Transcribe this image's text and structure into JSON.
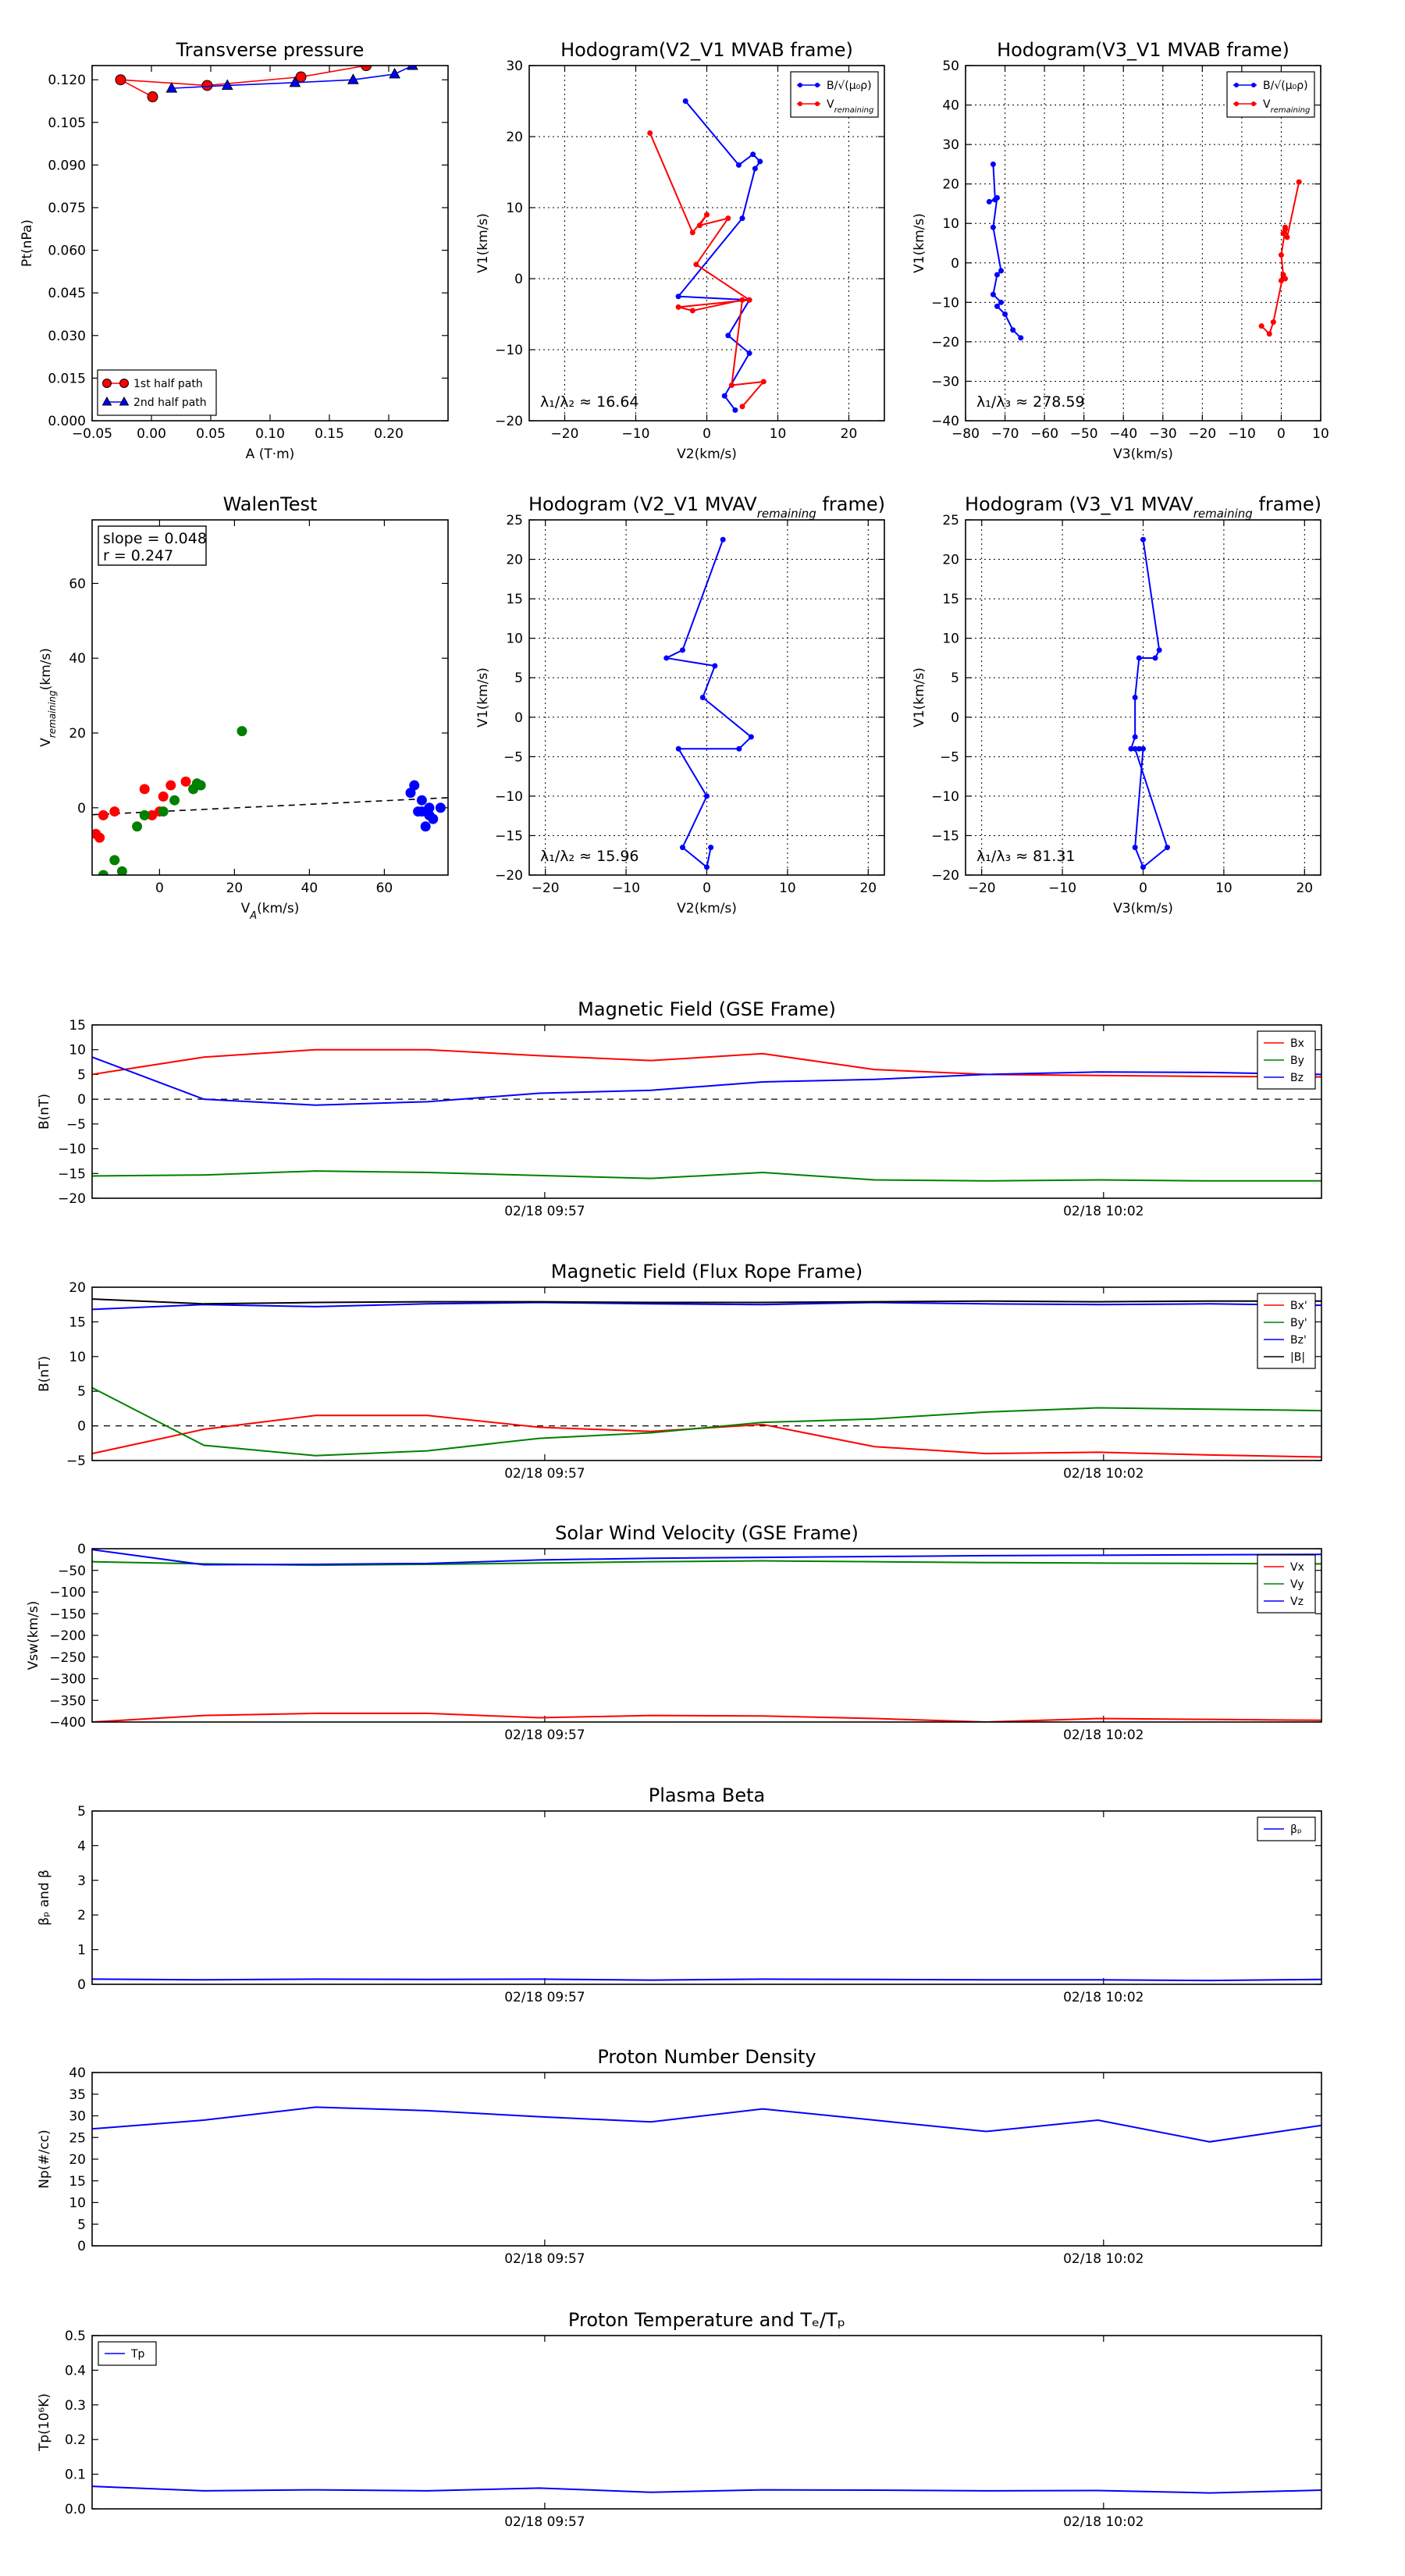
{
  "chart_data": [
    {
      "id": "transverse",
      "type": "line",
      "title": "Transverse pressure",
      "xlabel": "A (T·m)",
      "ylabel": "Pt(nPa)",
      "xlim": [
        -0.05,
        0.25
      ],
      "ylim": [
        0.0,
        0.125
      ],
      "xticks": [
        -0.05,
        0.0,
        0.05,
        0.1,
        0.15,
        0.2
      ],
      "xticklabels": [
        "−0.05",
        "0.00",
        "0.05",
        "0.10",
        "0.15",
        "0.20"
      ],
      "yticks": [
        0,
        0.015,
        0.03,
        0.045,
        0.06,
        0.075,
        0.09,
        0.105,
        0.12
      ],
      "yticklabels": [
        "0.000",
        "0.015",
        "0.030",
        "0.045",
        "0.060",
        "0.075",
        "0.090",
        "0.105",
        "0.120"
      ],
      "legend_position": "lower-left",
      "series": [
        {
          "name": "1st half path",
          "color": "#ff0000",
          "marker": "circle",
          "x": [
            0.001,
            -0.026,
            0.047,
            0.126,
            0.181,
            0.22,
            0.245
          ],
          "y": [
            0.114,
            0.12,
            0.118,
            0.121,
            0.125,
            0.126,
            0.128
          ]
        },
        {
          "name": "2nd half path",
          "color": "#0000ff",
          "marker": "triangle",
          "x": [
            0.017,
            0.064,
            0.121,
            0.17,
            0.205,
            0.22
          ],
          "y": [
            0.117,
            0.118,
            0.119,
            0.12,
            0.122,
            0.125
          ]
        }
      ]
    },
    {
      "id": "hodo_v2_mvab",
      "type": "line",
      "title": "Hodogram(V2_V1 MVAB frame)",
      "xlabel": "V2(km/s)",
      "ylabel": "V1(km/s)",
      "xlim": [
        -25,
        25
      ],
      "ylim": [
        -20,
        30
      ],
      "xticks": [
        -20,
        -10,
        0,
        10,
        20
      ],
      "yticks": [
        -20,
        -10,
        0,
        10,
        20,
        30
      ],
      "grid": true,
      "legend_position": "top-right",
      "annotation": "λ₁/λ₂ ≈ 16.64",
      "series": [
        {
          "name": "B/√(μ₀ρ)",
          "color": "#0000ff",
          "x": [
            -3,
            4.5,
            6.5,
            7.5,
            6.8,
            5,
            -4,
            6,
            3,
            6,
            2.5,
            4
          ],
          "y": [
            25,
            16,
            17.5,
            16.5,
            15.5,
            8.5,
            -2.5,
            -3,
            -8,
            -10.5,
            -16.5,
            -18.5
          ]
        },
        {
          "name": "V_remaining",
          "color": "#ff0000",
          "x": [
            -8,
            -2,
            0,
            -1,
            3,
            -1.5,
            6,
            -4,
            -2,
            5,
            3.5,
            8,
            5
          ],
          "y": [
            20.5,
            6.5,
            9,
            7.5,
            8.5,
            2,
            -3,
            -4,
            -4.5,
            -3,
            -15,
            -14.5,
            -18
          ]
        }
      ]
    },
    {
      "id": "hodo_v3_mvab",
      "type": "line",
      "title": "Hodogram(V3_V1 MVAB frame)",
      "xlabel": "V3(km/s)",
      "ylabel": "V1(km/s)",
      "xlim": [
        -80,
        10
      ],
      "ylim": [
        -40,
        50
      ],
      "xticks": [
        -80,
        -70,
        -60,
        -50,
        -40,
        -30,
        -20,
        -10,
        0,
        10
      ],
      "yticks": [
        -40,
        -30,
        -20,
        -10,
        0,
        10,
        20,
        30,
        40,
        50
      ],
      "grid": true,
      "legend_position": "top-right",
      "annotation": "λ₁/λ₃ ≈ 278.59",
      "series": [
        {
          "name": "B/√(μ₀ρ)",
          "color": "#0000ff",
          "x": [
            -73,
            -72.5,
            -74,
            -72,
            -73,
            -71,
            -72,
            -73,
            -71,
            -72,
            -70,
            -68,
            -66
          ],
          "y": [
            25,
            16,
            15.5,
            16.5,
            9,
            -2,
            -3,
            -8,
            -10,
            -11,
            -13,
            -17,
            -19
          ]
        },
        {
          "name": "V_remaining",
          "color": "#ff0000",
          "x": [
            4.5,
            1.5,
            1,
            0.5,
            1,
            0,
            0.5,
            1,
            0,
            0.5,
            -2,
            -3,
            -5
          ],
          "y": [
            20.5,
            6.5,
            9,
            7.5,
            8.5,
            2,
            -3,
            -4,
            -4.5,
            -3,
            -15,
            -18,
            -16
          ]
        }
      ]
    },
    {
      "id": "walen",
      "type": "scatter",
      "title": "WalenTest",
      "xlabel": "V_A(km/s)",
      "ylabel": "V_remaining(km/s)",
      "xlim": [
        -18,
        77
      ],
      "ylim": [
        -18,
        77
      ],
      "xticks": [
        0,
        20,
        40,
        60
      ],
      "yticks": [
        0,
        20,
        40,
        60
      ],
      "annotation_lines": [
        "slope = 0.048",
        "r = 0.247"
      ],
      "fit": {
        "slope": 0.048,
        "intercept": -1.0
      },
      "series": [
        {
          "color": "#ff0000",
          "x": [
            -17,
            -16,
            -15,
            -12,
            -4,
            1,
            3,
            7,
            0,
            -2
          ],
          "y": [
            -7,
            -8,
            -2,
            -1,
            5,
            3,
            6,
            7,
            -1,
            -2
          ]
        },
        {
          "color": "#008000",
          "x": [
            -15,
            -12,
            -10,
            -6,
            -4,
            1,
            4,
            9,
            10,
            11,
            22
          ],
          "y": [
            -18,
            -14,
            -17,
            -5,
            -2,
            -1,
            2,
            5,
            6.5,
            6,
            20.5
          ]
        },
        {
          "color": "#0000ff",
          "x": [
            67,
            68,
            69,
            70,
            71,
            72,
            73,
            70,
            71,
            72,
            75
          ],
          "y": [
            4,
            6,
            -1,
            2,
            -1,
            0,
            -3,
            -1,
            -5,
            -2,
            0
          ]
        }
      ]
    },
    {
      "id": "hodo_v2_mvav",
      "type": "line",
      "title": "Hodogram (V2_V1 MVAV_remaining frame)",
      "xlabel": "V2(km/s)",
      "ylabel": "V1(km/s)",
      "xlim": [
        -22,
        22
      ],
      "ylim": [
        -20,
        25
      ],
      "xticks": [
        -20,
        -10,
        0,
        10,
        20
      ],
      "yticks": [
        -20,
        -15,
        -10,
        -5,
        0,
        5,
        10,
        15,
        20,
        25
      ],
      "grid": true,
      "annotation": "λ₁/λ₂ ≈ 15.96",
      "series": [
        {
          "color": "#0000ff",
          "x": [
            2,
            -3,
            -5,
            1,
            -0.5,
            5.5,
            4,
            -3.5,
            0,
            -3,
            0,
            0.5
          ],
          "y": [
            22.5,
            8.5,
            7.5,
            6.5,
            2.5,
            -2.5,
            -4,
            -4,
            -10,
            -16.5,
            -19,
            -16.5
          ]
        }
      ]
    },
    {
      "id": "hodo_v3_mvav",
      "type": "line",
      "title": "Hodogram (V3_V1 MVAV_remaining frame)",
      "xlabel": "V3(km/s)",
      "ylabel": "V1(km/s)",
      "xlim": [
        -22,
        22
      ],
      "ylim": [
        -20,
        25
      ],
      "xticks": [
        -20,
        -10,
        0,
        10,
        20
      ],
      "yticks": [
        -20,
        -15,
        -10,
        -5,
        0,
        5,
        10,
        15,
        20,
        25
      ],
      "grid": true,
      "annotation": "λ₁/λ₃ ≈ 81.31",
      "series": [
        {
          "color": "#0000ff",
          "x": [
            0,
            2,
            1.5,
            -0.5,
            -1,
            -1,
            -1.5,
            -0.5,
            -1,
            3,
            0,
            -1,
            0
          ],
          "y": [
            22.5,
            8.5,
            7.5,
            7.5,
            2.5,
            -2.5,
            -4,
            -4,
            -4,
            -16.5,
            -19,
            -16.5,
            -4
          ]
        }
      ]
    },
    {
      "id": "mag_gse",
      "type": "line",
      "title": "Magnetic Field (GSE Frame)",
      "ylabel": "B(nT)",
      "ylim": [
        -20,
        15
      ],
      "yticks": [
        -20,
        -15,
        -10,
        -5,
        0,
        5,
        10,
        15
      ],
      "x_ticks": [
        {
          "label": "02/18 09:57",
          "pos": 4.05
        },
        {
          "label": "02/18 10:02",
          "pos": 9.05
        }
      ],
      "x": [
        0,
        1,
        2,
        3,
        4,
        5,
        6,
        7,
        8,
        9,
        10,
        11
      ],
      "zero_line": true,
      "legend_position": "top-right",
      "series": [
        {
          "name": "Bx",
          "color": "#ff0000",
          "values": [
            5,
            8.5,
            10,
            10,
            8.8,
            7.8,
            9.2,
            6,
            5,
            4.8,
            4.6,
            4.5
          ]
        },
        {
          "name": "By",
          "color": "#008000",
          "values": [
            -15.5,
            -15.3,
            -14.5,
            -14.8,
            -15.4,
            -16,
            -14.8,
            -16.3,
            -16.5,
            -16.3,
            -16.5,
            -16.5
          ]
        },
        {
          "name": "Bz",
          "color": "#0000ff",
          "values": [
            8.5,
            0,
            -1.2,
            -0.5,
            1.2,
            1.8,
            3.5,
            4,
            5,
            5.5,
            5.4,
            5
          ]
        }
      ]
    },
    {
      "id": "mag_fr",
      "type": "line",
      "title": "Magnetic Field (Flux Rope Frame)",
      "ylabel": "B(nT)",
      "ylim": [
        -5,
        20
      ],
      "yticks": [
        -5,
        0,
        5,
        10,
        15,
        20
      ],
      "x_ticks": [
        {
          "label": "02/18 09:57",
          "pos": 4.05
        },
        {
          "label": "02/18 10:02",
          "pos": 9.05
        }
      ],
      "x": [
        0,
        1,
        2,
        3,
        4,
        5,
        6,
        7,
        8,
        9,
        10,
        11
      ],
      "zero_line": true,
      "legend_position": "top-right",
      "series": [
        {
          "name": "Bx'",
          "color": "#ff0000",
          "values": [
            -4,
            -0.5,
            1.5,
            1.5,
            -0.2,
            -0.8,
            0.2,
            -3,
            -4,
            -3.8,
            -4.2,
            -4.5
          ]
        },
        {
          "name": "By'",
          "color": "#008000",
          "values": [
            5.5,
            -2.8,
            -4.3,
            -3.6,
            -1.8,
            -1,
            0.5,
            1,
            2,
            2.6,
            2.4,
            2.2
          ]
        },
        {
          "name": "Bz'",
          "color": "#0000ff",
          "values": [
            16.8,
            17.5,
            17.2,
            17.6,
            17.8,
            17.6,
            17.5,
            17.8,
            17.6,
            17.5,
            17.6,
            17.4
          ]
        },
        {
          "name": "|B|",
          "color": "#000000",
          "values": [
            18.3,
            17.6,
            17.8,
            17.9,
            17.9,
            17.8,
            17.8,
            17.9,
            18,
            17.9,
            18,
            18
          ]
        }
      ]
    },
    {
      "id": "vsw",
      "type": "line",
      "title": "Solar Wind Velocity (GSE Frame)",
      "ylabel": "Vsw(km/s)",
      "ylim": [
        -400,
        0
      ],
      "yticks": [
        -400,
        -350,
        -300,
        -250,
        -200,
        -150,
        -100,
        -50,
        0
      ],
      "x_ticks": [
        {
          "label": "02/18 09:57",
          "pos": 4.05
        },
        {
          "label": "02/18 10:02",
          "pos": 9.05
        }
      ],
      "x": [
        0,
        1,
        2,
        3,
        4,
        5,
        6,
        7,
        8,
        9,
        10,
        11
      ],
      "legend_position": "top-right",
      "series": [
        {
          "name": "Vx",
          "color": "#ff0000",
          "values": [
            -400,
            -385,
            -380,
            -380,
            -390,
            -385,
            -386,
            -392,
            -400,
            -392,
            -394,
            -396
          ]
        },
        {
          "name": "Vy",
          "color": "#008000",
          "values": [
            -30,
            -35,
            -38,
            -36,
            -33,
            -30,
            -28,
            -30,
            -32,
            -33,
            -34,
            -35
          ]
        },
        {
          "name": "Vz",
          "color": "#0000ff",
          "values": [
            -2,
            -37,
            -36,
            -34,
            -26,
            -22,
            -20,
            -18,
            -16,
            -15,
            -14,
            -13
          ]
        }
      ]
    },
    {
      "id": "beta",
      "type": "line",
      "title": "Plasma Beta",
      "ylabel": "β_p and β",
      "ylim": [
        0,
        5
      ],
      "yticks": [
        0,
        1,
        2,
        3,
        4,
        5
      ],
      "x_ticks": [
        {
          "label": "02/18 09:57",
          "pos": 4.05
        },
        {
          "label": "02/18 10:02",
          "pos": 9.05
        }
      ],
      "x": [
        0,
        1,
        2,
        3,
        4,
        5,
        6,
        7,
        8,
        9,
        10,
        11
      ],
      "legend_position": "top-right",
      "series": [
        {
          "name": "β_p",
          "color": "#0000ff",
          "values": [
            0.15,
            0.13,
            0.15,
            0.14,
            0.15,
            0.12,
            0.15,
            0.14,
            0.13,
            0.13,
            0.11,
            0.14
          ]
        }
      ]
    },
    {
      "id": "np",
      "type": "line",
      "title": "Proton Number Density",
      "ylabel": "Np(#/cc)",
      "ylim": [
        0,
        40
      ],
      "yticks": [
        0,
        5,
        10,
        15,
        20,
        25,
        30,
        35,
        40
      ],
      "x_ticks": [
        {
          "label": "02/18 09:57",
          "pos": 4.05
        },
        {
          "label": "02/18 10:02",
          "pos": 9.05
        }
      ],
      "x": [
        0,
        1,
        2,
        3,
        4,
        5,
        6,
        7,
        8,
        9,
        10,
        11
      ],
      "series": [
        {
          "color": "#0000ff",
          "values": [
            27,
            29,
            32,
            31.2,
            29.8,
            28.6,
            31.6,
            29,
            26.4,
            29,
            24,
            27.8
          ]
        }
      ]
    },
    {
      "id": "tp",
      "type": "line",
      "title": "Proton Temperature and T_e/T_p",
      "ylabel": "Tp(10⁶K)",
      "ylim": [
        0,
        0.5
      ],
      "yticks": [
        0,
        0.1,
        0.2,
        0.3,
        0.4,
        0.5
      ],
      "yticklabels": [
        "0.0",
        "0.1",
        "0.2",
        "0.3",
        "0.4",
        "0.5"
      ],
      "x_ticks": [
        {
          "label": "02/18 09:57",
          "pos": 4.05
        },
        {
          "label": "02/18 10:02",
          "pos": 9.05
        }
      ],
      "x": [
        0,
        1,
        2,
        3,
        4,
        5,
        6,
        7,
        8,
        9,
        10,
        11
      ],
      "legend_position": "top-left",
      "series": [
        {
          "name": "Tp",
          "color": "#0000ff",
          "values": [
            0.065,
            0.052,
            0.055,
            0.052,
            0.06,
            0.048,
            0.055,
            0.054,
            0.052,
            0.053,
            0.046,
            0.054
          ]
        }
      ]
    }
  ]
}
